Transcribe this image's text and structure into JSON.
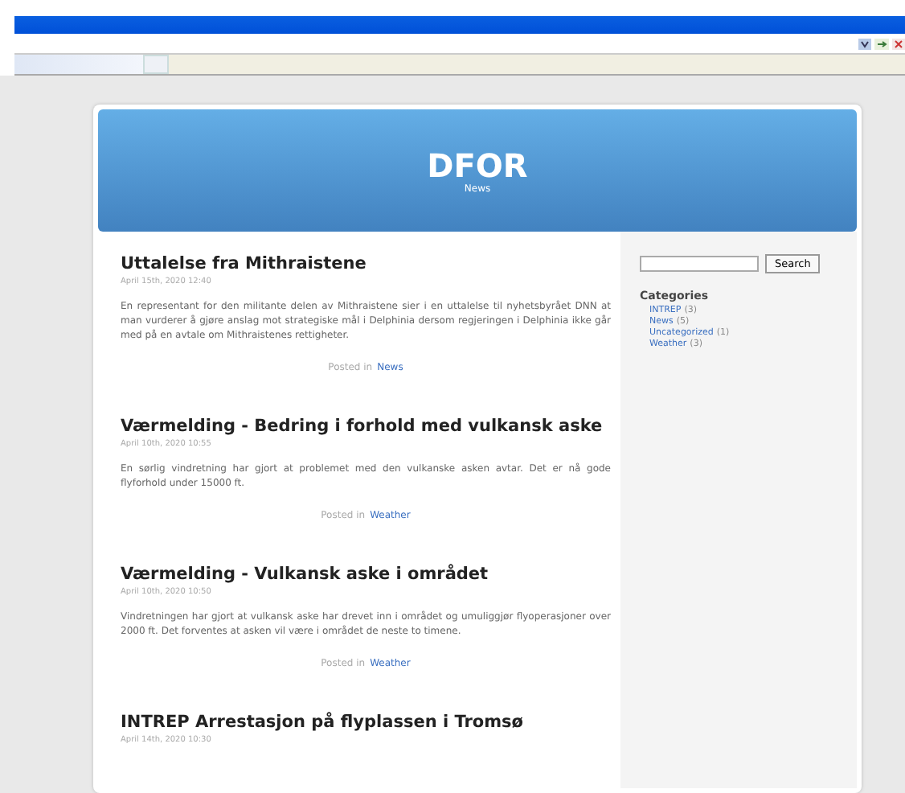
{
  "site": {
    "title": "DFOR",
    "tagline": "News"
  },
  "posts": [
    {
      "title": "Uttalelse fra Mithraistene",
      "date": "April 15th, 2020 12:40",
      "body": "En representant for den militante delen av Mithraistene sier i en uttalelse til nyhetsbyrået DNN at man vurderer å gjøre anslag mot strategiske mål i Delphinia dersom regjeringen i Delphinia ikke går med på en avtale om Mithraistenes rettigheter.",
      "posted_in": "Posted in",
      "category": "News"
    },
    {
      "title": "Værmelding - Bedring i forhold med vulkansk aske",
      "date": "April 10th, 2020 10:55",
      "body": "En sørlig vindretning har gjort at problemet med den vulkanske asken avtar. Det er nå gode flyforhold under 15000 ft.",
      "posted_in": "Posted in",
      "category": "Weather"
    },
    {
      "title": "Værmelding - Vulkansk aske i området",
      "date": "April 10th, 2020 10:50",
      "body": "Vindretningen har gjort at vulkansk aske har drevet inn i området og umuliggjør flyoperasjoner over 2000 ft. Det forventes at asken vil være i området de neste to timene.",
      "posted_in": "Posted in",
      "category": "Weather"
    },
    {
      "title": "INTREP Arrestasjon på flyplassen i Tromsø",
      "date": "April 14th, 2020 10:30"
    }
  ],
  "sidebar": {
    "search_button": "Search",
    "categories_title": "Categories",
    "categories": [
      {
        "name": "INTREP",
        "count": "(3)"
      },
      {
        "name": "News",
        "count": "(5)"
      },
      {
        "name": "Uncategorized",
        "count": "(1)"
      },
      {
        "name": "Weather",
        "count": "(3)"
      }
    ]
  }
}
